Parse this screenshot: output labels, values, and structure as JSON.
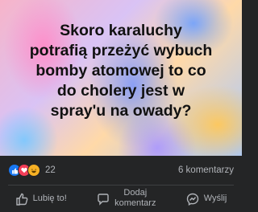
{
  "post": {
    "text": "Skoro karaluchy\npotrafią przeżyć wybuch\nbomby atomowej to co\ndo cholery jest w\nspray'u na owady?"
  },
  "reactions": {
    "icons": [
      "like-icon",
      "love-icon",
      "haha-icon"
    ],
    "count": "22",
    "comments": "6 komentarzy"
  },
  "actions": {
    "like": "Lubię to!",
    "comment": "Dodaj\nkomentarz",
    "share": "Wyślij"
  },
  "colors": {
    "background": "#242526",
    "text_muted": "#b0b3b8",
    "like_blue": "#1877f2",
    "love_red": "#f33e58",
    "haha_yellow": "#f7b125"
  }
}
